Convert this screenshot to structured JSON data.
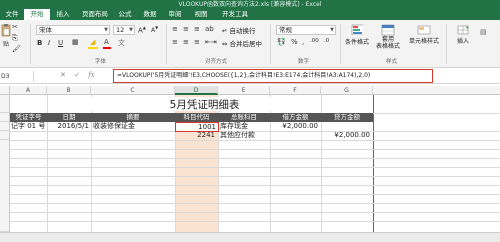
{
  "window": {
    "title": "VLOOKUP函数双向查询方法2.xls [兼容模式] - Excel"
  },
  "tabs": [
    "文件",
    "开始",
    "插入",
    "页面布局",
    "公式",
    "数据",
    "审阅",
    "视图",
    "开发工具"
  ],
  "ribbon": {
    "paste_label": "贴",
    "font_name": "宋体",
    "font_size": "12",
    "wrap_text": "自动换行",
    "merge_center": "合并后居中",
    "number_format": "常规",
    "conditional_format": "条件格式",
    "table_format": "套用\n表格格式",
    "cell_styles": "单元格样式",
    "insert": "插入",
    "groups": {
      "font": "字体",
      "alignment": "对齐方式",
      "number": "数字",
      "styles": "样式"
    }
  },
  "formula_bar": {
    "name_box": "D3",
    "formula": "=VLOOKUP('5月凭证明细'!E3,CHOOSE({1,2},会计科目!E3:E174,会计科目!A3:A174),2,0)"
  },
  "sheet": {
    "columns": [
      "A",
      "B",
      "C",
      "D",
      "E",
      "F",
      "G"
    ],
    "selected_column": "D",
    "title": "5月凭证明细表",
    "headers": [
      "凭证字号",
      "日期",
      "摘要",
      "科目代码",
      "总账科目",
      "借方金额",
      "贷方金额"
    ],
    "rows": [
      [
        "记字 01 号",
        "2016/5/1",
        "收装修保证金",
        "1001",
        "库存现金",
        "¥2,000.00",
        ""
      ],
      [
        "",
        "",
        "",
        "2241",
        "其他应付款",
        "",
        "¥2,000.00"
      ]
    ],
    "colors": {
      "header_bg": "#555555",
      "selected_col_bg": "#fbe3d2",
      "selected_border": "#d9382b",
      "accent": "#217346"
    }
  }
}
